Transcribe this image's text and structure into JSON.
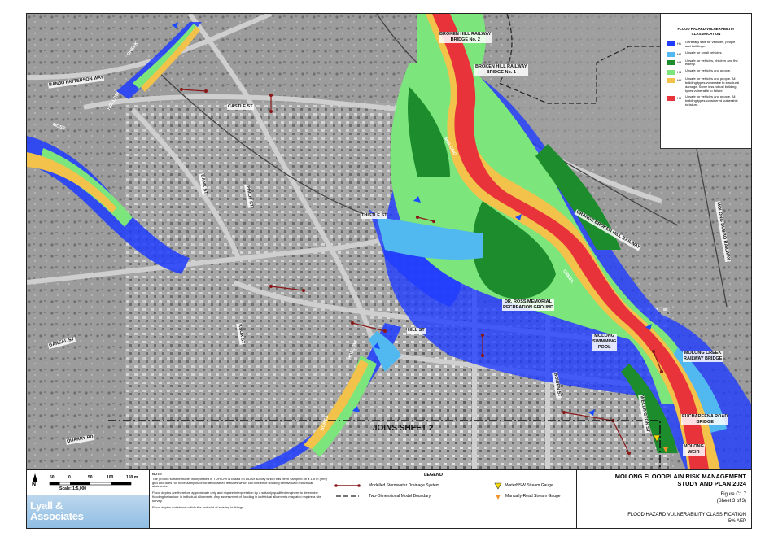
{
  "map": {
    "streets": [
      {
        "name": "street-label",
        "text": "BANJO PATTERSON WAY"
      },
      {
        "name": "street-label",
        "text": "CASTLE ST"
      },
      {
        "name": "street-label",
        "text": "BANK ST"
      },
      {
        "name": "street-label",
        "text": "PHILIP ST"
      },
      {
        "name": "street-label",
        "text": "THISTLE ST"
      },
      {
        "name": "street-label",
        "text": "KNOX ST"
      },
      {
        "name": "street-label",
        "text": "HILL ST"
      },
      {
        "name": "street-label",
        "text": "QUARRY RD"
      },
      {
        "name": "street-label",
        "text": "GAREAL ST"
      },
      {
        "name": "street-label",
        "text": "BOWEN ST"
      },
      {
        "name": "street-label",
        "text": "WELLINGTON ST"
      },
      {
        "name": "street-label",
        "text": "ORANGE BROKEN HILL RAILWAY"
      },
      {
        "name": "street-label",
        "text": "MOLONG DUBBO RAILWAY"
      }
    ],
    "features": {
      "bridge2": "BROKEN HILL RAILWAY\nBRIDGE No. 2",
      "bridge1": "BROKEN HILL RAILWAY\nBRIDGE No. 1",
      "recreation": "DR. ROSS MEMORIAL\nRECREATION GROUND",
      "pool": "MOLONG\nSWIMMING\nPOOL",
      "creek_bridge": "MOLONG CREEK\nRAILWAY BRIDGE",
      "euchareena": "EUCHAREENA ROAD\nBRIDGE",
      "weir": "MOLONG\nWEIR"
    },
    "waterways": {
      "moss_creek_1": "MOSS",
      "moss_creek_2": "CREEK",
      "hollow_1": "HOLLOW",
      "hollow_2": "HOLLOW",
      "molong": "MOLONG",
      "creek": "CREEK",
      "bores": "BORES"
    },
    "joins": "JOINS SHEET 2"
  },
  "hazard_legend": {
    "title": "FLOOD HAZARD VULNERABILITY\nCLASSIFICATION",
    "classes": [
      {
        "code": "H1",
        "color": "#1f3cff",
        "desc": "Generally safe for vehicles, people and buildings."
      },
      {
        "code": "H2",
        "color": "#52b8f0",
        "desc": "Unsafe for small vehicles."
      },
      {
        "code": "H3",
        "color": "#1d8c2c",
        "desc": "Unsafe for vehicles, children and the elderly."
      },
      {
        "code": "H4",
        "color": "#7ce67c",
        "desc": "Unsafe for vehicles and people."
      },
      {
        "code": "H5",
        "color": "#f2c24a",
        "desc": "Unsafe for vehicles and people. All building types vulnerable to structural damage. Some less robust building types vulnerable to failure."
      },
      {
        "code": "H6",
        "color": "#e8333a",
        "desc": "Unsafe for vehicles and people. All building types considered vulnerable to failure."
      }
    ]
  },
  "footer": {
    "north": "N",
    "scale_ticks": [
      "50",
      "0",
      "50",
      "100",
      "150 m"
    ],
    "scale_text": "Scale: 1:5,000",
    "logo": "Lyall &\nAssociates",
    "note_title": "NOTE:",
    "notes": [
      "The ground surface model incorporated in TUFLOW is based on LiDAR survey which has been sampled on a 1.5 m (mm) grid and does not necessarily incorporate localised features which can influence flooding behaviour in individual allotments.",
      "Flood depths are therefore approximate only and require interpretation by a suitably qualified engineer to determine flooding behaviour in individual allotments. Any assessment of flooding in individual allotments may also require a site survey.",
      "Flood depths not shown within the footprint of existing buildings."
    ],
    "legend_title": "LEGEND",
    "legend_items": {
      "stormwater": "Modelled Stormwater Drainage System",
      "boundary": "Two-Dimensional Model Boundary",
      "waternsw": "WaterNSW Stream Gauge",
      "manual": "Manually-Read Stream Gauge"
    },
    "title_main": "MOLONG FLOODPLAIN RISK MANAGEMENT\nSTUDY AND PLAN 2024",
    "figure": "Figure C1.7\n(Sheet 3 of 3)",
    "classification": "FLOOD HAZARD VULNERABILITY CLASSIFICATION\n5% AEP"
  }
}
